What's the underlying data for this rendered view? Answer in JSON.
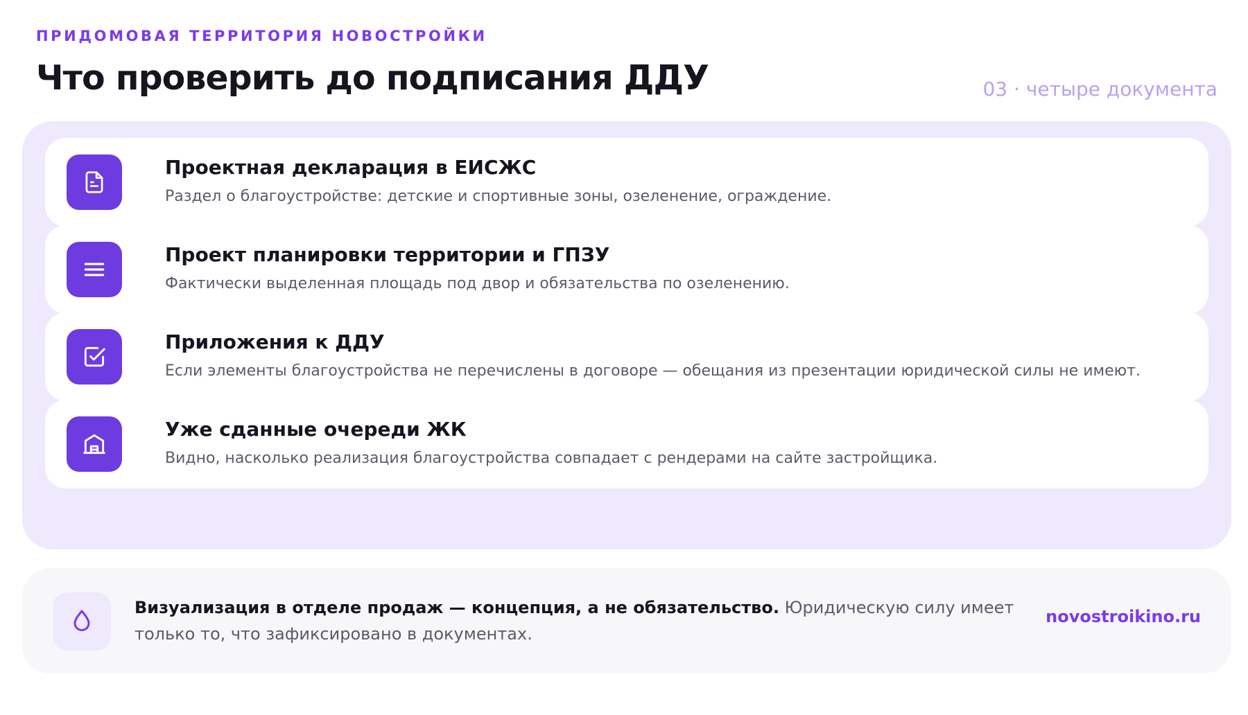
{
  "header": {
    "eyebrow": "ПРИДОМОВАЯ ТЕРРИТОРИЯ НОВОСТРОЙКИ",
    "title": "Что проверить до подписания ДДУ",
    "counter": "03 · четыре документа"
  },
  "cards": [
    {
      "icon": "document-icon",
      "title": "Проектная декларация в ЕИСЖС",
      "description": "Раздел о благоустройстве: детские и спортивные зоны, озеленение, ограждение."
    },
    {
      "icon": "list-icon",
      "title": "Проект планировки территории и ГПЗУ",
      "description": "Фактически выделенная площадь под двор и обязательства по озеленению."
    },
    {
      "icon": "checkbox-icon",
      "title": "Приложения к ДДУ",
      "description": "Если элементы благоустройства не перечислены в договоре — обещания из презентации юридической силы не имеют."
    },
    {
      "icon": "building-icon",
      "title": "Уже сданные очереди ЖК",
      "description": "Видно, насколько реализация благоустройства совпадает с рендерами на сайте застройщика."
    }
  ],
  "note": {
    "icon": "drop-icon",
    "bold": "Визуализация в отделе продаж — концепция, а не обязательство.",
    "text": " Юридическую силу имеет только то, что зафиксировано в документах.",
    "brand": "novostroikino.ru"
  },
  "colors": {
    "accent": "#7c3aed",
    "icon_bg": "#6d3be0",
    "panel_bg": "#efe9fd",
    "note_bg": "#f7f7fa",
    "counter": "#b7a2ef"
  }
}
